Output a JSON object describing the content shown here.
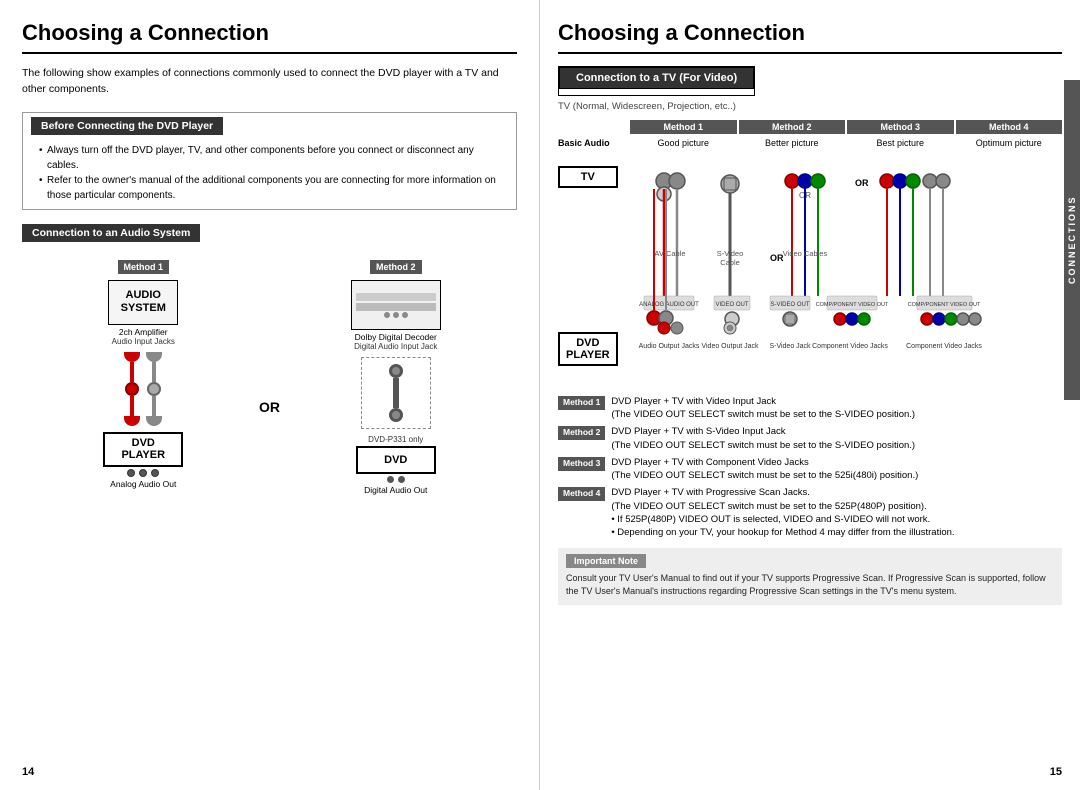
{
  "left_page": {
    "title": "Choosing a Connection",
    "intro": "The following show examples of connections commonly used to connect the DVD player with a TV and other components.",
    "before_connecting": {
      "header": "Before Connecting the DVD Player",
      "bullets": [
        "Always turn off the DVD player, TV, and other components before you connect or disconnect any cables.",
        "Refer to the owner's manual of the additional components you are connecting for more information on those particular components."
      ]
    },
    "audio_section": {
      "header": "Connection to an Audio System",
      "method1": {
        "badge": "Method 1",
        "device_label": "AUDIO\nSYSTEM",
        "sub_label": "2ch Amplifier",
        "jack_label": "Audio Input Jacks",
        "dvd_label": "DVD\nPLAYER",
        "dvd_out": "Analog Audio Out"
      },
      "or_text": "OR",
      "method2": {
        "badge": "Method 2",
        "device_label": "Dolby Digital Decoder",
        "jack_label": "Digital Audio Input Jack",
        "dvd_note": "DVD-P331 only",
        "dvd_out": "Digital Audio Out"
      }
    },
    "page_number": "14"
  },
  "right_page": {
    "title": "Choosing a Connection",
    "tv_section": {
      "header": "Connection to a TV (For Video)",
      "subtitle": "TV (Normal, Widescreen, Projection, etc..)",
      "methods": [
        {
          "badge": "Method 1",
          "quality": "Basic Audio",
          "description": ""
        },
        {
          "badge": "Method 2",
          "quality": "Good\npicture",
          "description": ""
        },
        {
          "badge": "Method 3",
          "quality": "Better\npicture",
          "description": ""
        },
        {
          "badge": "Method 4",
          "quality": "Best\npicture",
          "description": ""
        }
      ],
      "method5": {
        "badge": "Method 4",
        "quality": "Optimum\npicture"
      },
      "tv_label": "TV",
      "dvd_label": "DVD\nPLAYER",
      "cable_labels": {
        "av_cable": "AV Cable",
        "svideo_cable": "S-Video\nCable",
        "video_cables": "Video Cables"
      },
      "or_texts": [
        "OR",
        "OR"
      ],
      "jack_labels": {
        "audio_out": "Audio Output Jacks",
        "video_out": "Video Output Jack",
        "svideo": "S-Video Jack",
        "component1": "Component Video Jacks",
        "component2": "Component Video Jacks"
      }
    },
    "method_notes": [
      {
        "badge": "Method 1",
        "text": "DVD Player + TV with Video Input Jack\n(The VIDEO OUT SELECT switch must be set to the S-VIDEO position.)"
      },
      {
        "badge": "Method 2",
        "text": "DVD Player + TV with S-Video Input Jack\n(The VIDEO OUT SELECT switch must be set to the S-VIDEO position.)"
      },
      {
        "badge": "Method 3",
        "text": "DVD Player + TV with Component Video Jacks\n(The VIDEO OUT SELECT switch must be set to the 525i(480i) position.)"
      },
      {
        "badge": "Method 4",
        "text": "DVD Player + TV with Progressive Scan Jacks.\n(The VIDEO OUT SELECT switch must be set to the 525P(480P) position).\n• If 525P(480P) VIDEO OUT is selected, VIDEO and S-VIDEO will not work.\n• Depending on your TV, your hookup for Method 4 may differ from the illustration."
      }
    ],
    "important_note": {
      "header": "Important Note",
      "text": "Consult your TV User's Manual to find out if your TV supports Progressive Scan. If Progressive Scan is supported, follow the TV User's Manual's instructions regarding Progressive Scan settings in the TV's menu system."
    },
    "connections_sidebar": "CONNECTIONS",
    "page_number": "15"
  }
}
